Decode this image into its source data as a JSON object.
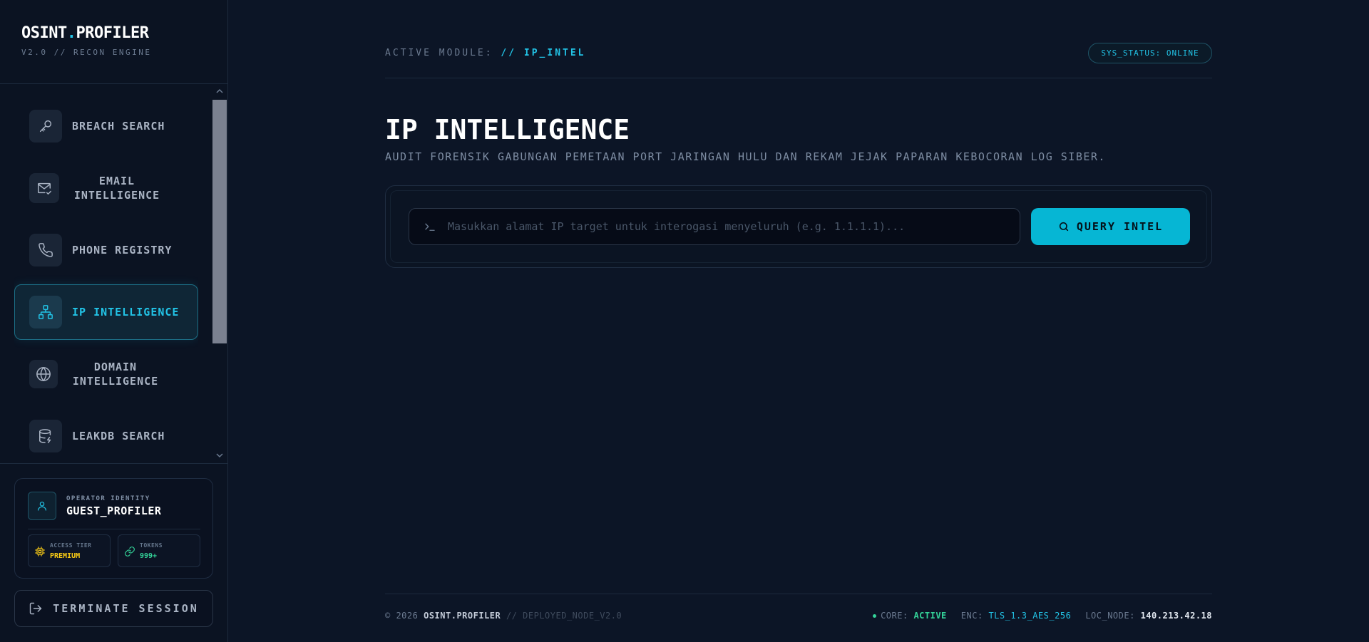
{
  "brand": {
    "title_part1": "OSINT",
    "title_dot": ".",
    "title_part2": "PROFILER",
    "subtitle": "V2.0 // RECON ENGINE"
  },
  "sidebar": {
    "items": [
      {
        "label": "BREACH SEARCH",
        "icon": "key-icon",
        "active": false
      },
      {
        "label": "EMAIL INTELLIGENCE",
        "icon": "mail-check-icon",
        "active": false
      },
      {
        "label": "PHONE REGISTRY",
        "icon": "phone-icon",
        "active": false
      },
      {
        "label": "IP INTELLIGENCE",
        "icon": "network-icon",
        "active": true
      },
      {
        "label": "DOMAIN INTELLIGENCE",
        "icon": "globe-icon",
        "active": false
      },
      {
        "label": "LEAKDB SEARCH",
        "icon": "database-icon",
        "active": false
      }
    ]
  },
  "operator": {
    "kicker": "OPERATOR IDENTITY",
    "name": "GUEST_PROFILER",
    "access_label": "ACCESS TIER",
    "access_value": "PREMIUM",
    "tokens_label": "TOKENS",
    "tokens_value": "999+"
  },
  "terminate_label": "TERMINATE SESSION",
  "header": {
    "module_prefix": "ACTIVE MODULE:",
    "module_value": "// IP_INTEL",
    "status": "SYS_STATUS: ONLINE"
  },
  "page": {
    "title": "IP INTELLIGENCE",
    "subtitle": "AUDIT FORENSIK GABUNGAN PEMETAAN PORT JARINGAN HULU DAN REKAM JEJAK PAPARAN KEBOCORAN LOG SIBER."
  },
  "query": {
    "placeholder": "Masukkan alamat IP target untuk interogasi menyeluruh (e.g. 1.1.1.1)...",
    "value": "",
    "button_label": "QUERY INTEL"
  },
  "footer": {
    "copyright": "© 2026",
    "brand": "OSINT.PROFILER",
    "node": "// DEPLOYED_NODE_V2.0",
    "core_label": "CORE:",
    "core_value": "ACTIVE",
    "enc_label": "ENC:",
    "enc_value": "TLS_1.3_AES_256",
    "loc_label": "LOC_NODE:",
    "loc_value": "140.213.42.18"
  },
  "colors": {
    "accent": "#22c3e6",
    "button": "#06b6d4",
    "background": "#0c1526",
    "premium": "#facc15",
    "tokens": "#34d399"
  }
}
